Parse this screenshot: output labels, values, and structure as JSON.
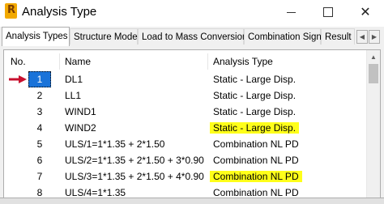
{
  "window": {
    "title": "Analysis Type",
    "app_icon_letter": "R",
    "minimize_glyph": "",
    "maximize_glyph": "",
    "close_glyph": "✕"
  },
  "tabs": [
    {
      "label": "Analysis Types",
      "active": true
    },
    {
      "label": "Structure Model",
      "active": false
    },
    {
      "label": "Load to Mass Conversion",
      "active": false
    },
    {
      "label": "Combination Sign",
      "active": false
    },
    {
      "label": "Result",
      "active": false
    }
  ],
  "tab_scroll": {
    "left": "◀",
    "right": "▶"
  },
  "list": {
    "columns": {
      "no": "No.",
      "name": "Name",
      "type": "Analysis Type"
    },
    "rows": [
      {
        "no": "1",
        "name": "DL1",
        "type": "Static - Large Disp.",
        "selected": true,
        "highlight": false
      },
      {
        "no": "2",
        "name": "LL1",
        "type": "Static - Large Disp.",
        "selected": false,
        "highlight": false
      },
      {
        "no": "3",
        "name": "WIND1",
        "type": "Static - Large Disp.",
        "selected": false,
        "highlight": false
      },
      {
        "no": "4",
        "name": "WIND2",
        "type": "Static - Large Disp.",
        "selected": false,
        "highlight": true
      },
      {
        "no": "5",
        "name": "ULS/1=1*1.35 + 2*1.50",
        "type": "Combination NL PD",
        "selected": false,
        "highlight": false
      },
      {
        "no": "6",
        "name": "ULS/2=1*1.35 + 2*1.50 + 3*0.90",
        "type": "Combination NL PD",
        "selected": false,
        "highlight": false
      },
      {
        "no": "7",
        "name": "ULS/3=1*1.35 + 2*1.50 + 4*0.90",
        "type": "Combination NL PD",
        "selected": false,
        "highlight": true
      },
      {
        "no": "8",
        "name": "ULS/4=1*1.35",
        "type": "Combination NL PD",
        "selected": false,
        "highlight": false
      }
    ]
  },
  "scrollbar": {
    "up_glyph": "▲"
  },
  "colors": {
    "selection": "#1a73d9",
    "highlight": "#ffff1a",
    "arrow": "#c8102e"
  },
  "icons": {
    "row_pointer": "red-arrow-icon",
    "app": "robot-app-icon"
  }
}
